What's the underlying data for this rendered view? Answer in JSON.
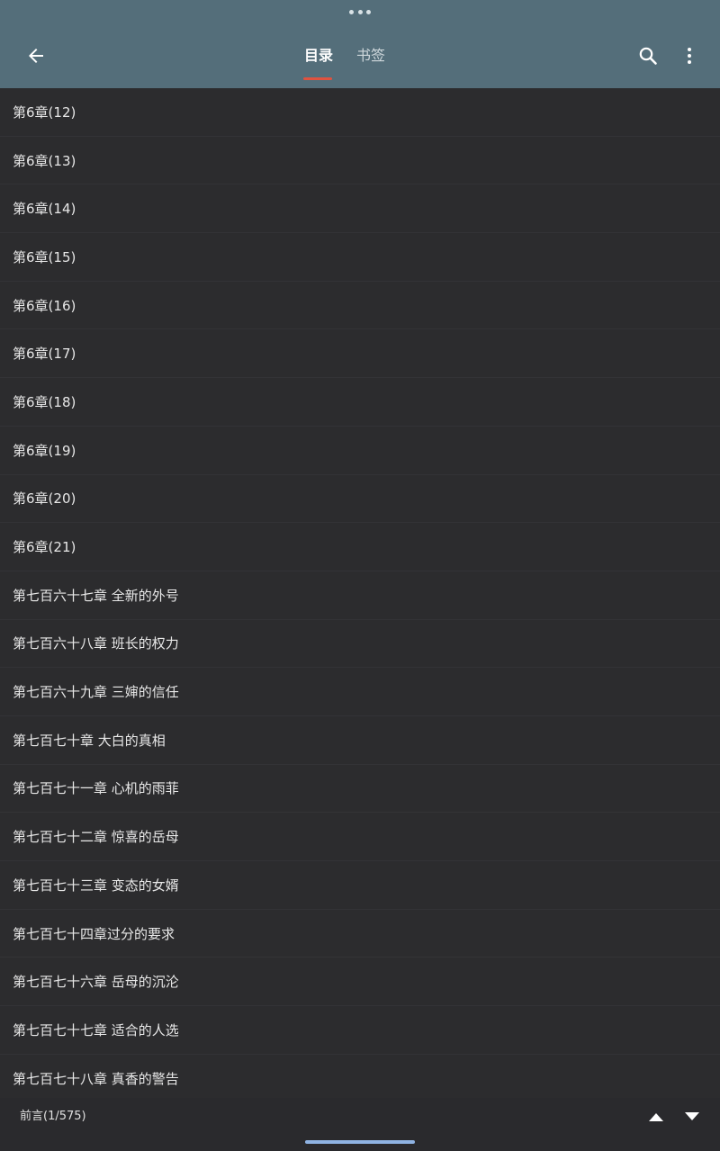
{
  "header": {
    "tabs": [
      {
        "label": "目录",
        "active": true
      },
      {
        "label": "书签",
        "active": false
      }
    ],
    "accent_color": "#e0523f",
    "background_color": "#546e7a",
    "icons": {
      "back": "arrow-left-icon",
      "search": "search-icon",
      "more": "more-vertical-icon",
      "grip": "drag-handle-icon"
    }
  },
  "chapters": [
    "第6章(12)",
    "第6章(13)",
    "第6章(14)",
    "第6章(15)",
    "第6章(16)",
    "第6章(17)",
    "第6章(18)",
    "第6章(19)",
    "第6章(20)",
    "第6章(21)",
    "第七百六十七章 全新的外号",
    "第七百六十八章 班长的权力",
    "第七百六十九章 三婶的信任",
    "第七百七十章 大白的真相",
    "第七百七十一章 心机的雨菲",
    "第七百七十二章 惊喜的岳母",
    "第七百七十三章 变态的女婿",
    "第七百七十四章过分的要求",
    "第七百七十六章 岳母的沉沦",
    "第七百七十七章 适合的人选",
    "第七百七十八章 真香的警告"
  ],
  "footer": {
    "progress": "前言(1/575)",
    "icons": {
      "up": "triangle-up-icon",
      "down": "triangle-down-icon"
    }
  }
}
